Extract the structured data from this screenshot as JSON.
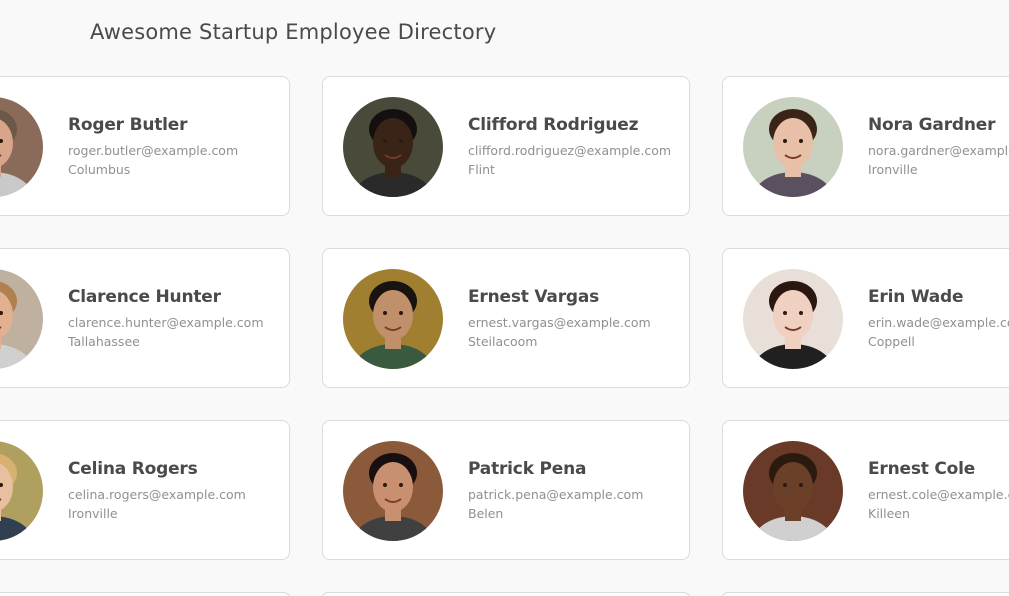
{
  "page": {
    "title": "Awesome Startup Employee Directory"
  },
  "employees": [
    {
      "name": "Roger Butler",
      "email": "roger.butler@example.com",
      "city": "Columbus",
      "skin": "#d9a58a",
      "hair": "#6b5848",
      "bg": "#8a6a58",
      "shirt": "#c9c9c9"
    },
    {
      "name": "Clifford Rodriguez",
      "email": "clifford.rodriguez@example.com",
      "city": "Flint",
      "skin": "#3a2418",
      "hair": "#151010",
      "bg": "#4a4a3a",
      "shirt": "#2a2a2a"
    },
    {
      "name": "Nora Gardner",
      "email": "nora.gardner@example.com",
      "city": "Ironville",
      "skin": "#e8c0a8",
      "hair": "#3a2418",
      "bg": "#c8d0c0",
      "shirt": "#5a5060"
    },
    {
      "name": "Clarence Hunter",
      "email": "clarence.hunter@example.com",
      "city": "Tallahassee",
      "skin": "#e0b090",
      "hair": "#b08050",
      "bg": "#c0b0a0",
      "shirt": "#d0d0d0"
    },
    {
      "name": "Ernest Vargas",
      "email": "ernest.vargas@example.com",
      "city": "Steilacoom",
      "skin": "#c0906a",
      "hair": "#1a1410",
      "bg": "#a08030",
      "shirt": "#3a5a40"
    },
    {
      "name": "Erin Wade",
      "email": "erin.wade@example.com",
      "city": "Coppell",
      "skin": "#f0d0c0",
      "hair": "#2a1810",
      "bg": "#e8e0d8",
      "shirt": "#202020"
    },
    {
      "name": "Celina Rogers",
      "email": "celina.rogers@example.com",
      "city": "Ironville",
      "skin": "#e8c0a0",
      "hair": "#d8b070",
      "bg": "#b0a060",
      "shirt": "#304050"
    },
    {
      "name": "Patrick Pena",
      "email": "patrick.pena@example.com",
      "city": "Belen",
      "skin": "#c89070",
      "hair": "#181010",
      "bg": "#8a5a3a",
      "shirt": "#404040"
    },
    {
      "name": "Ernest Cole",
      "email": "ernest.cole@example.com",
      "city": "Killeen",
      "skin": "#6a4028",
      "hair": "#2a1a10",
      "bg": "#6a3a28",
      "shirt": "#d0d0d0"
    }
  ]
}
